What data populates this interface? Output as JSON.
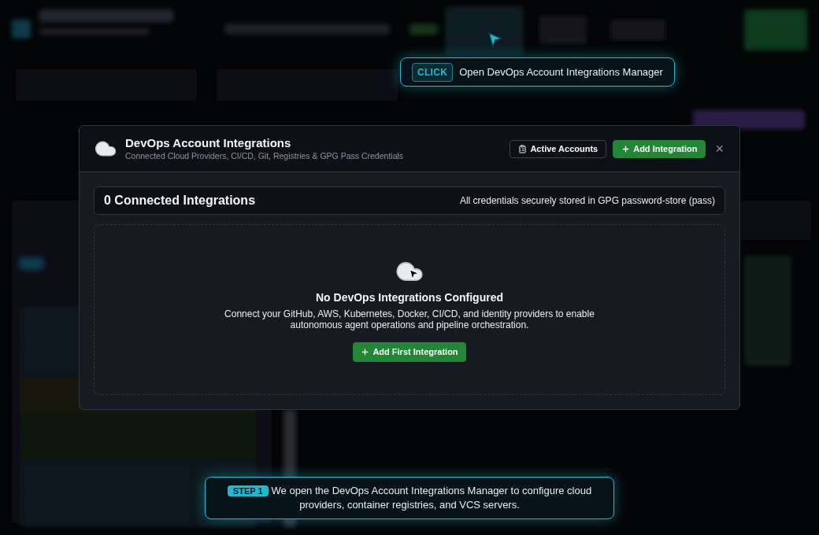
{
  "hint": {
    "badge": "CLICK",
    "text": "Open DevOps Account Integrations Manager"
  },
  "dialog": {
    "title": "DevOps Account Integrations",
    "subtitle": "Connected Cloud Providers, CI/CD, Git, Registries & GPG Pass Credentials",
    "buttons": [
      {
        "label": "Active Accounts",
        "kind": "secondary"
      },
      {
        "label": "Add Integration",
        "kind": "primary"
      }
    ],
    "close": "×",
    "summary": {
      "count": "0 Connected Integrations",
      "note": "All credentials securely stored in GPG password-store (pass)"
    },
    "empty": {
      "title": "No DevOps Integrations Configured",
      "text": "Connect your GitHub, AWS, Kubernetes, Docker, CI/CD, and identity providers to enable autonomous agent operations and pipeline orchestration.",
      "button": "Add First Integration"
    }
  },
  "step": {
    "badge": "STEP 1",
    "text": "We open the DevOps Account Integrations Manager to configure cloud providers, container registries, and VCS servers."
  }
}
